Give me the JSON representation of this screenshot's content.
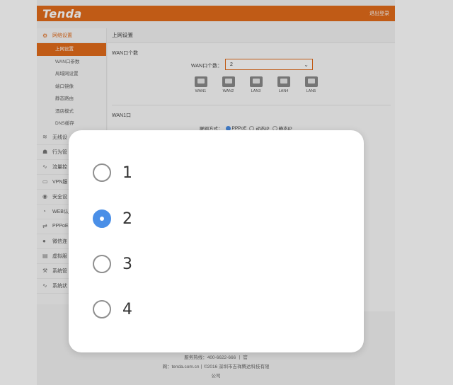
{
  "header": {
    "logo": "Tenda",
    "logout": "退出登录"
  },
  "sidebar": {
    "groups": [
      {
        "label": "网络设置",
        "icon": "gear-icon",
        "active": true,
        "items": [
          "上网设置",
          "WAN口参数",
          "局域网设置",
          "端口镜像",
          "静态路由",
          "酒店模式",
          "DNS缓存"
        ]
      },
      {
        "label": "无线设",
        "icon": "wifi-icon"
      },
      {
        "label": "行为管",
        "icon": "user-icon"
      },
      {
        "label": "流量控",
        "icon": "chart-icon"
      },
      {
        "label": "VPN服",
        "icon": "monitor-icon"
      },
      {
        "label": "安全设",
        "icon": "shield-icon"
      },
      {
        "label": "WEB认",
        "icon": "web-icon"
      },
      {
        "label": "PPPoE",
        "icon": "link-icon"
      },
      {
        "label": "微信连",
        "icon": "wechat-icon"
      },
      {
        "label": "虚拟服",
        "icon": "server-icon"
      },
      {
        "label": "系统管",
        "icon": "tools-icon"
      },
      {
        "label": "系统状",
        "icon": "status-icon"
      }
    ]
  },
  "content": {
    "title": "上网设置",
    "wan_count_section": "WAN口个数",
    "wan_count_label": "WAN口个数：",
    "wan_count_value": "2",
    "ports": [
      "WAN1",
      "WAN2",
      "LAN3",
      "LAN4",
      "LAN5"
    ],
    "wan1_section": "WAN1口",
    "conn_mode_label": "联网方式：",
    "conn_modes": [
      "PPPoE",
      "动态IP",
      "静态IP"
    ]
  },
  "footer": {
    "line1": "服务热线：400-6622-666 丨 官",
    "line2": "网：tenda.com.cn丨©2016 深圳市吉祥腾达科技有限",
    "line3": "公司"
  },
  "dialog": {
    "options": [
      "1",
      "2",
      "3",
      "4"
    ],
    "selected": "2"
  },
  "colors": {
    "brand": "#e26b1b",
    "accent": "#4a8fe7"
  }
}
